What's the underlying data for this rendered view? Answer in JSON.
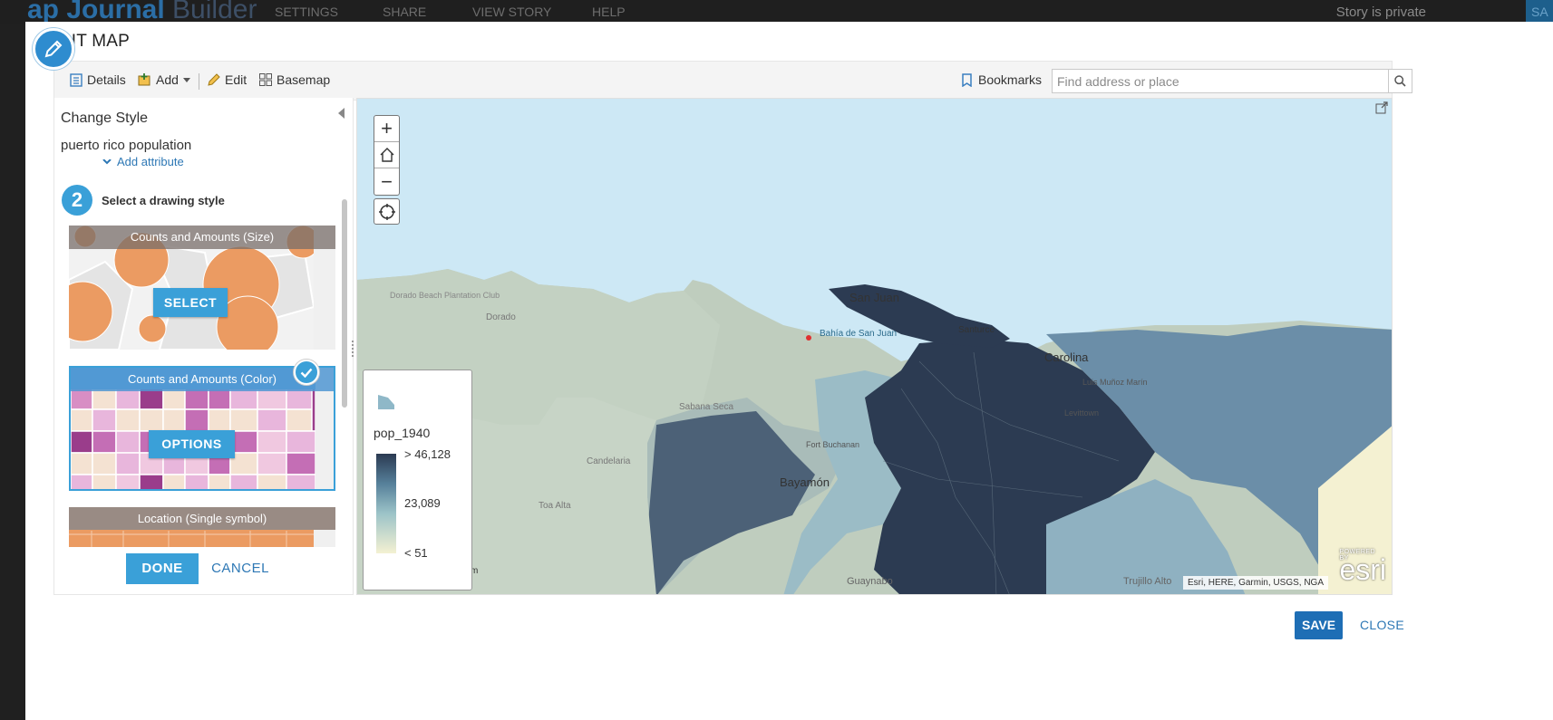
{
  "topbar": {
    "app_title_prefix": "ap Journal",
    "app_title_suffix": "Builder",
    "nav": [
      "SETTINGS",
      "SHARE",
      "VIEW STORY",
      "HELP"
    ],
    "story_status": "Story is private",
    "save_partial": "SA"
  },
  "dialog": {
    "title": "EDIT MAP",
    "save_label": "SAVE",
    "close_label": "CLOSE"
  },
  "toolbar": {
    "details": "Details",
    "add": "Add",
    "edit": "Edit",
    "basemap": "Basemap",
    "bookmarks": "Bookmarks",
    "search_placeholder": "Find address or place"
  },
  "style_panel": {
    "heading": "Change Style",
    "layer_name": "puerto rico population",
    "add_attribute": "Add attribute",
    "step_number": "2",
    "step_label": "Select a drawing style",
    "cards": [
      {
        "title": "Counts and Amounts (Size)",
        "button": "SELECT",
        "selected": false
      },
      {
        "title": "Counts and Amounts (Color)",
        "button": "OPTIONS",
        "selected": true
      },
      {
        "title": "Location (Single symbol)",
        "button": "",
        "selected": false
      }
    ],
    "done_label": "DONE",
    "cancel_label": "CANCEL"
  },
  "map": {
    "places": [
      "San Juan",
      "Bahía de San Juan",
      "Santurce",
      "Carolina",
      "Bayamón",
      "Guaynabo",
      "Trujillo Alto",
      "Sabana Seca",
      "Candelaria",
      "Toa Alta",
      "Dorado",
      "Dorado Beach Plantation Club",
      "Fort Buchanan",
      "Luis Muñoz Marín",
      "Levittown"
    ],
    "scale_partial": "km",
    "attribution": "Esri, HERE, Garmin, USGS, NGA",
    "esri_logo": "esri",
    "powered_by": "POWERED BY",
    "legend": {
      "field": "pop_1940",
      "max_label": "> 46,128",
      "mid_label": "23,089",
      "min_label": "< 51"
    },
    "colors": {
      "water": "#cde8f5",
      "low": "#f4f1d2",
      "mid": "#9cc3c8",
      "high": "#2b3a52"
    }
  }
}
